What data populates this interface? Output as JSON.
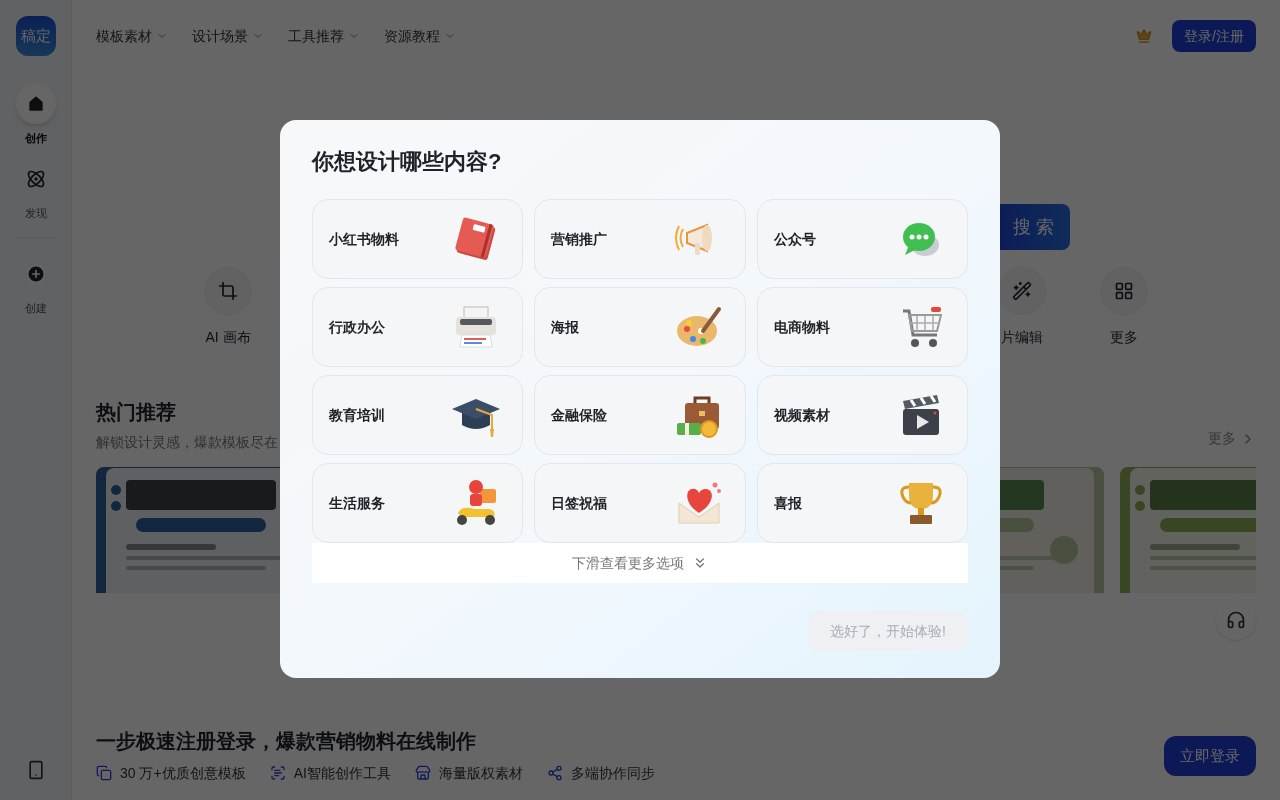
{
  "sidebar": {
    "logo": "稿定",
    "items": [
      {
        "label": "创作",
        "kind": "create",
        "selected": true
      },
      {
        "label": "发现",
        "kind": "discover",
        "selected": false
      },
      {
        "label": "创建",
        "kind": "add",
        "selected": false
      }
    ]
  },
  "nav": {
    "menus": [
      "模板素材",
      "设计场景",
      "工具推荐",
      "资源教程"
    ],
    "login": "登录/注册"
  },
  "search_button": "搜 索",
  "tools": [
    {
      "label": "AI 画布",
      "kind": "canvas"
    },
    {
      "label": "片编辑",
      "kind": "magic"
    },
    {
      "label": "更多",
      "kind": "grid"
    }
  ],
  "hot": {
    "title": "热门推荐",
    "subtitle": "解锁设计灵感，爆款模板尽在",
    "more": "更多"
  },
  "register_bar": {
    "title": "一步极速注册登录，爆款营销物料在线制作",
    "features": [
      {
        "label": "30 万+优质创意模板",
        "kind": "template"
      },
      {
        "label": "AI智能创作工具",
        "kind": "ai"
      },
      {
        "label": "海量版权素材",
        "kind": "store"
      },
      {
        "label": "多端协作同步",
        "kind": "sync"
      }
    ],
    "button": "立即登录"
  },
  "modal": {
    "title": "你想设计哪些内容?",
    "options": [
      {
        "label": "小红书物料",
        "kind": "book",
        "selected": false
      },
      {
        "label": "营销推广",
        "kind": "megaphone",
        "selected": false
      },
      {
        "label": "公众号",
        "kind": "chat",
        "selected": false
      },
      {
        "label": "行政办公",
        "kind": "printer",
        "selected": false
      },
      {
        "label": "海报",
        "kind": "palette",
        "selected": false
      },
      {
        "label": "电商物料",
        "kind": "cart",
        "selected": false
      },
      {
        "label": "教育培训",
        "kind": "cap",
        "selected": false
      },
      {
        "label": "金融保险",
        "kind": "money",
        "selected": false
      },
      {
        "label": "视频素材",
        "kind": "clapper",
        "selected": false
      },
      {
        "label": "生活服务",
        "kind": "scooter",
        "selected": false
      },
      {
        "label": "日签祝福",
        "kind": "letter",
        "selected": false
      },
      {
        "label": "喜报",
        "kind": "trophy",
        "selected": false
      }
    ],
    "scroll_hint": "下滑查看更多选项",
    "confirm": {
      "label": "选好了，开始体验!",
      "disabled": true
    }
  }
}
